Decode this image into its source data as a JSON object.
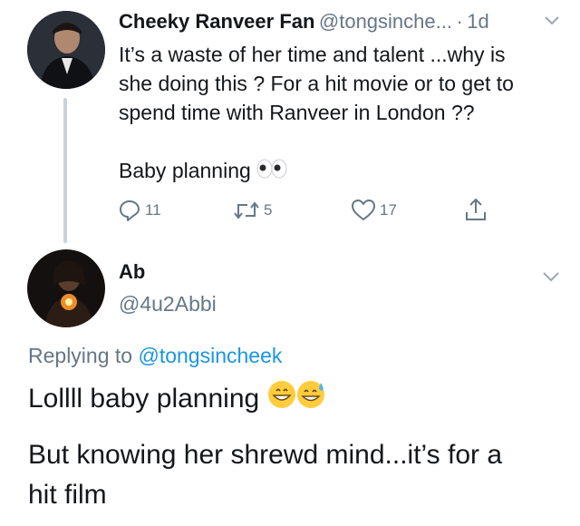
{
  "tweet1": {
    "display_name": "Cheeky Ranveer Fan",
    "handle": "@tongsinche...",
    "separator": "·",
    "time": "1d",
    "text_line1": "It’s a waste of her time and talent ...why is",
    "text_line2": "she doing this ? For a hit movie or to get to",
    "text_line3": "spend time with Ranveer in London ??",
    "text_line4": "Baby planning",
    "emoji_eyes": "eyes-emoji",
    "actions": {
      "reply_count": "11",
      "retweet_count": "5",
      "like_count": "17"
    }
  },
  "tweet2": {
    "display_name": "Ab",
    "handle": "@4u2Abbi",
    "replying_prefix": "Replying to",
    "replying_handle": "@tongsincheek",
    "text_line1": "Lollll baby planning",
    "emoji_grin": "grinning-emoji",
    "emoji_sweat": "grinning-sweat-emoji",
    "text_line2": "But knowing her shrewd mind...it’s for a",
    "text_line3": "hit film"
  },
  "colors": {
    "accent": "#1b95e0",
    "muted": "#657786",
    "thread_line": "#c8d3dc"
  }
}
